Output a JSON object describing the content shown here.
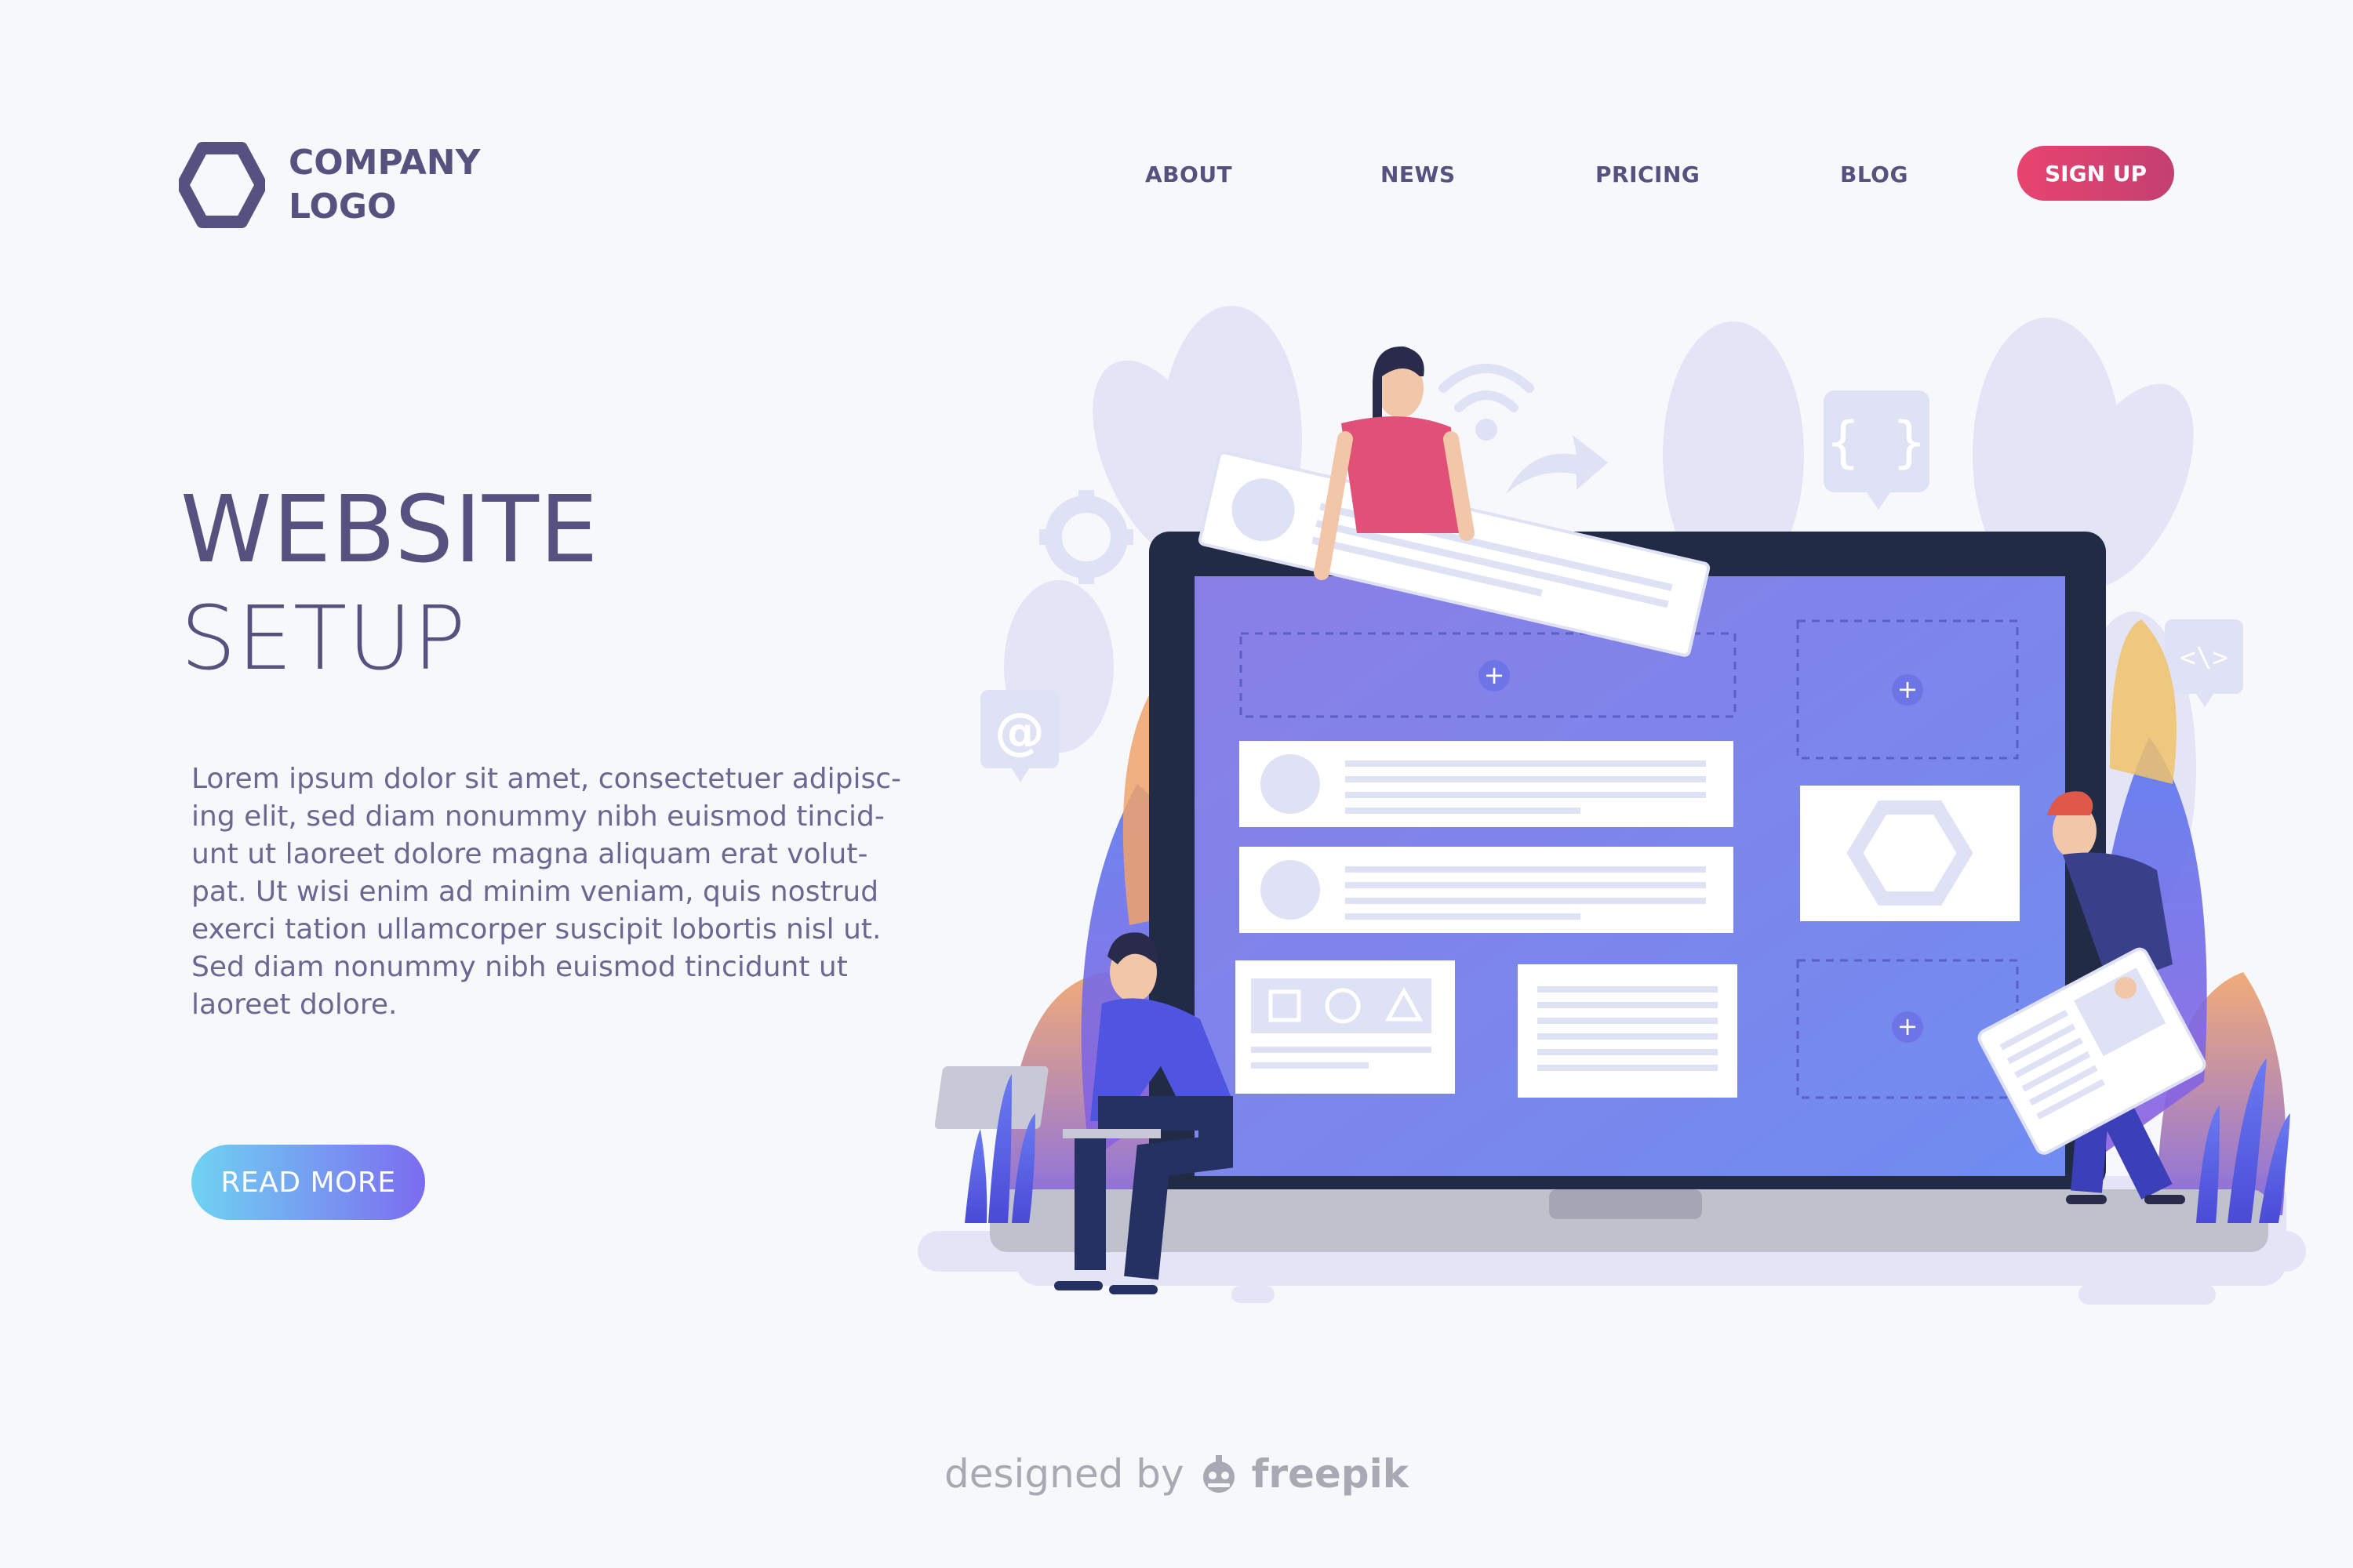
{
  "logo": {
    "line1": "COMPANY",
    "line2": "LOGO",
    "icon": "hexagon-icon"
  },
  "nav": {
    "items": [
      {
        "label": "ABOUT"
      },
      {
        "label": "NEWS"
      },
      {
        "label": "PRICING"
      },
      {
        "label": "BLOG"
      }
    ],
    "signup_label": "SIGN UP"
  },
  "hero": {
    "title": "WEBSITE",
    "subtitle": "SETUP",
    "body_lines": [
      "Lorem ipsum dolor sit amet, consectetuer adipisc-",
      "ing elit, sed diam nonummy nibh euismod tincid-",
      "unt ut laoreet dolore magna aliquam erat volut-",
      "pat. Ut wisi enim ad minim veniam, quis nostrud",
      "exerci tation ullamcorper suscipit lobortis nisl ut.",
      "Sed diam nonummy nibh euismod tincidunt ut",
      "laoreet dolore."
    ],
    "cta_label": "READ MORE"
  },
  "illustration": {
    "icons": [
      "wifi-icon",
      "code-braces-icon",
      "code-tag-icon",
      "at-sign-icon",
      "gear-icon",
      "arrow-icon"
    ],
    "code_braces_text": "{ }",
    "code_tag_text": "<\\>",
    "at_text": "@"
  },
  "credit": {
    "prefix": "designed by",
    "brand": "freepik"
  },
  "colors": {
    "primary_text": "#55527f",
    "signup_bg": "#e8446f",
    "cta_start": "#6fd3f2",
    "cta_end": "#7c6cf0",
    "screen": "#7f86ec",
    "laptop_frame": "#222b45"
  }
}
